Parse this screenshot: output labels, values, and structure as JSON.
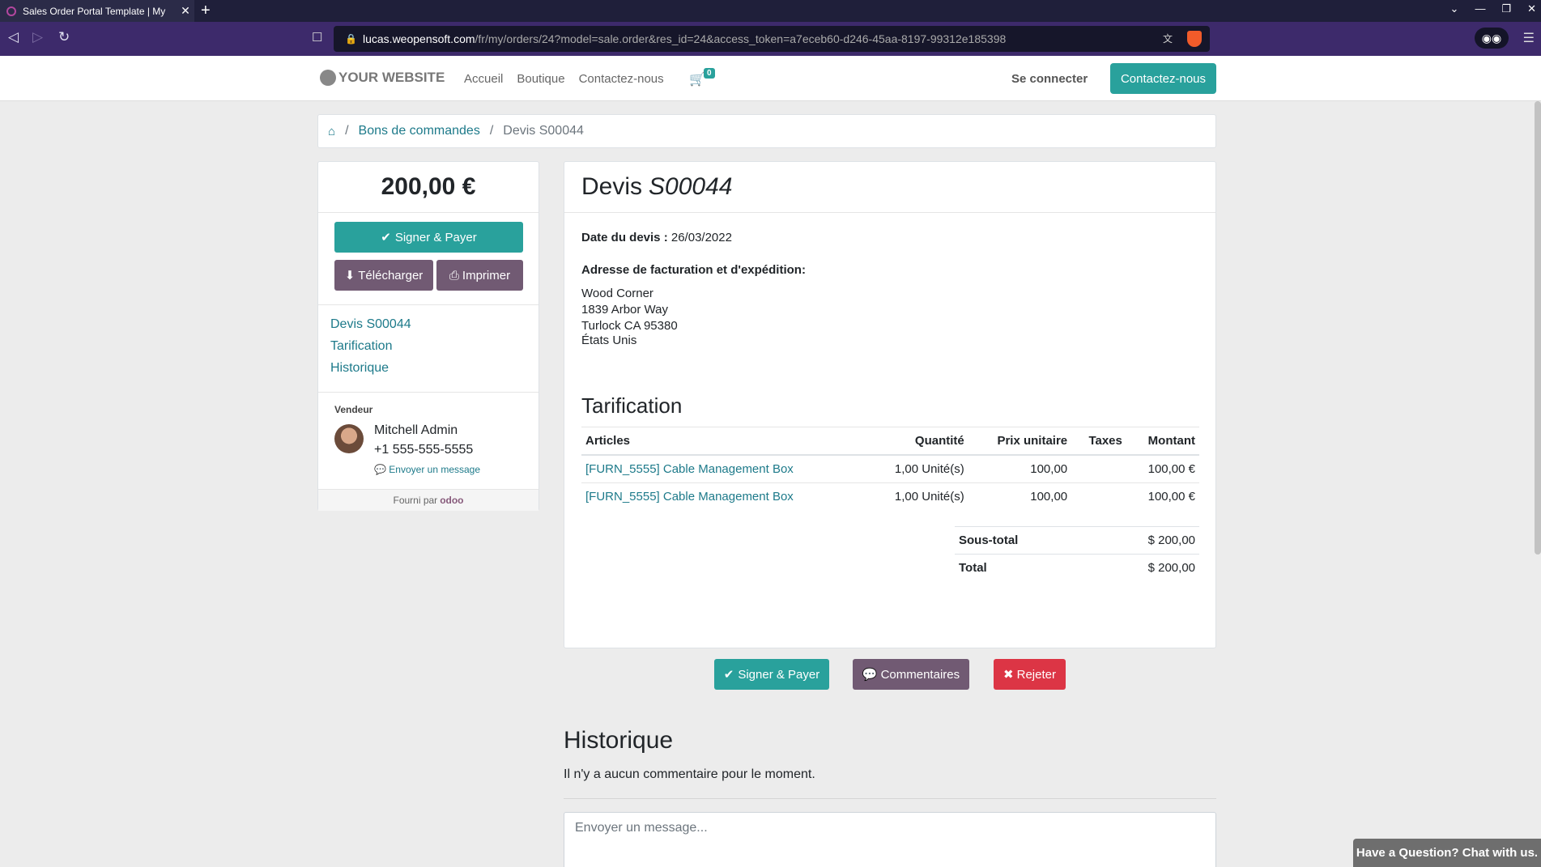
{
  "browser": {
    "tab_title": "Sales Order Portal Template | My",
    "tab_close": "✕",
    "new_tab": "+",
    "url_host": "lucas.weopensoft.com",
    "url_path": "/fr/my/orders/24?model=sale.order&res_id=24&access_token=a7eceb60-d246-45aa-8197-99312e185398"
  },
  "site": {
    "logo": "YOUR WEBSITE",
    "nav": [
      "Accueil",
      "Boutique",
      "Contactez-nous"
    ],
    "cart_count": "0",
    "login": "Se connecter",
    "contact_button": "Contactez-nous"
  },
  "breadcrumb": {
    "orders": "Bons de commandes",
    "current": "Devis S00044"
  },
  "sidebar": {
    "amount": "200,00 €",
    "sign_pay": "Signer & Payer",
    "download": "Télécharger",
    "print": "Imprimer",
    "nav": [
      "Devis S00044",
      "Tarification",
      "Historique"
    ],
    "vendor_label": "Vendeur",
    "vendor_name": "Mitchell Admin",
    "vendor_phone": "+1 555-555-5555",
    "send_message": "Envoyer un message",
    "powered_by": "Fourni par",
    "powered_brand": "odoo"
  },
  "quote": {
    "title_prefix": "Devis",
    "number": "S00044",
    "date_label": "Date du devis :",
    "date_value": "26/03/2022",
    "address_label": "Adresse de facturation et d'expédition:",
    "address_lines": [
      "Wood Corner",
      "1839 Arbor Way",
      "Turlock CA 95380",
      "États Unis"
    ],
    "pricing_title": "Tarification",
    "columns": [
      "Articles",
      "Quantité",
      "Prix unitaire",
      "Taxes",
      "Montant"
    ],
    "lines": [
      {
        "article": "[FURN_5555] Cable Management Box",
        "qty": "1,00 Unité(s)",
        "price": "100,00",
        "taxes": "",
        "amount": "100,00 €"
      },
      {
        "article": "[FURN_5555] Cable Management Box",
        "qty": "1,00 Unité(s)",
        "price": "100,00",
        "taxes": "",
        "amount": "100,00 €"
      }
    ],
    "subtotal_label": "Sous-total",
    "subtotal_value": "$ 200,00",
    "total_label": "Total",
    "total_value": "$ 200,00"
  },
  "actions": {
    "sign_pay": "Signer & Payer",
    "comments": "Commentaires",
    "reject": "Rejeter"
  },
  "history": {
    "title": "Historique",
    "empty": "Il n'y a aucun commentaire pour le moment.",
    "placeholder": "Envoyer un message..."
  },
  "chat": "Have a Question? Chat with us.",
  "colors": {
    "primary": "#29a19c",
    "secondary": "#715a73",
    "danger": "#dc3545",
    "link": "#1d7a8a",
    "browser_nav": "#3d2a6b"
  }
}
